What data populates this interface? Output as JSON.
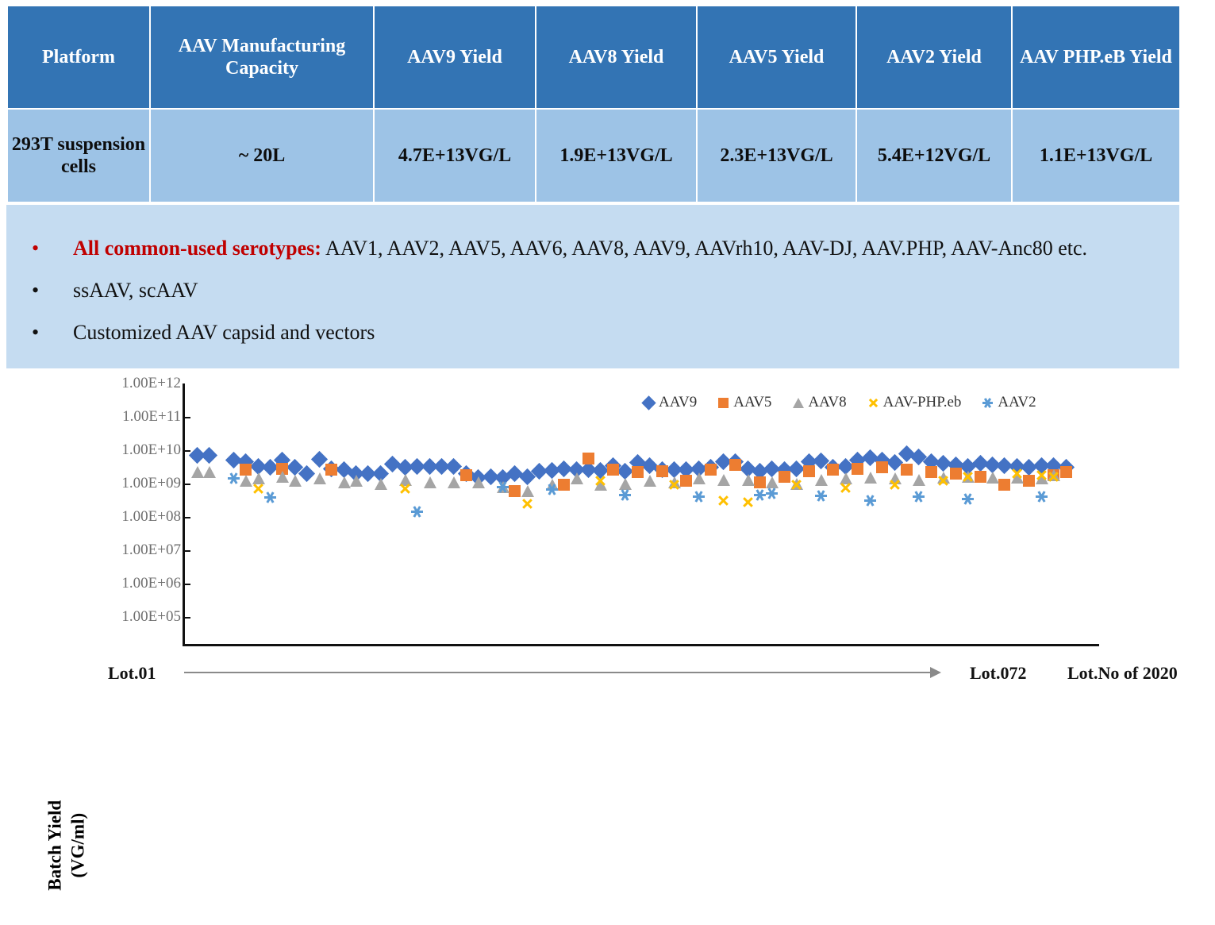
{
  "table": {
    "headers": [
      "Platform",
      "AAV Manufacturing Capacity",
      "AAV9 Yield",
      "AAV8 Yield",
      "AAV5 Yield",
      "AAV2 Yield",
      "AAV PHP.eB Yield"
    ],
    "row": [
      "293T suspension cells",
      "~ 20L",
      "4.7E+13VG/L",
      "1.9E+13VG/L",
      "2.3E+13VG/L",
      "5.4E+12VG/L",
      "1.1E+13VG/L"
    ],
    "header_bg": "#3374B4",
    "row_bg": "#9DC3E6",
    "platform_color": "#C00000"
  },
  "bullets": {
    "panel_bg": "#C5DCF1",
    "marker": "•",
    "items": [
      {
        "lead": "All common-used serotypes:",
        "rest": " AAV1, AAV2, AAV5, AAV6, AAV8, AAV9, AAVrh10, AAV-DJ, AAV.PHP, AAV-Anc80 etc.",
        "dot_color": "#C00000"
      },
      {
        "lead": "",
        "rest": "ssAAV, scAAV",
        "dot_color": "#111111"
      },
      {
        "lead": "",
        "rest": "Customized AAV capsid and vectors",
        "dot_color": "#111111"
      }
    ]
  },
  "chart_axis": {
    "y_title_line1": "Batch Yield",
    "y_title_line2": "(VG/ml)",
    "x_start_label": "Lot.01",
    "x_end_label": "Lot.072",
    "x_caption": "Lot.No of 2020"
  },
  "chart_data": {
    "type": "scatter",
    "title": "",
    "xlabel": "Lot.No of 2020",
    "ylabel": "Batch Yield (VG/ml)",
    "yscale": "log",
    "ylim": [
      100000.0,
      1000000000000.0
    ],
    "ytick_labels": [
      "1.00E+12",
      "1.00E+11",
      "1.00E+10",
      "1.00E+09",
      "1.00E+08",
      "1.00E+07",
      "1.00E+06",
      "1.00E+05"
    ],
    "ytick_values": [
      1000000000000.0,
      100000000000.0,
      10000000000.0,
      1000000000.0,
      100000000.0,
      10000000.0,
      1000000.0,
      100000.0
    ],
    "xlim": [
      1,
      72
    ],
    "grid": false,
    "legend_position": "top-right",
    "series": [
      {
        "name": "AAV9",
        "color": "#4472C4",
        "marker": "diamond",
        "x": [
          1,
          2,
          4,
          5,
          6,
          7,
          8,
          9,
          10,
          11,
          12,
          13,
          14,
          15,
          16,
          17,
          18,
          19,
          20,
          21,
          22,
          23,
          24,
          25,
          26,
          27,
          28,
          29,
          30,
          31,
          32,
          33,
          34,
          35,
          36,
          37,
          38,
          39,
          40,
          41,
          42,
          43,
          44,
          45,
          46,
          47,
          48,
          49,
          50,
          51,
          52,
          53,
          54,
          55,
          56,
          57,
          58,
          59,
          60,
          61,
          62,
          63,
          64,
          65,
          66,
          67,
          68,
          69,
          70,
          71,
          72
        ],
        "y": [
          7000000000.0,
          7000000000.0,
          5000000000.0,
          4600000000.0,
          3200000000.0,
          3100000000.0,
          5000000000.0,
          3000000000.0,
          2000000000.0,
          5300000000.0,
          2800000000.0,
          2600000000.0,
          2000000000.0,
          2000000000.0,
          2000000000.0,
          3800000000.0,
          3000000000.0,
          3200000000.0,
          3200000000.0,
          3200000000.0,
          3200000000.0,
          2000000000.0,
          1500000000.0,
          1600000000.0,
          1500000000.0,
          2000000000.0,
          1600000000.0,
          2400000000.0,
          2500000000.0,
          2700000000.0,
          2600000000.0,
          2600000000.0,
          2500000000.0,
          3500000000.0,
          2400000000.0,
          4200000000.0,
          3400000000.0,
          2600000000.0,
          2600000000.0,
          2600000000.0,
          2800000000.0,
          3000000000.0,
          4600000000.0,
          4600000000.0,
          2800000000.0,
          2400000000.0,
          2800000000.0,
          2600000000.0,
          2700000000.0,
          4600000000.0,
          4800000000.0,
          3000000000.0,
          3200000000.0,
          5000000000.0,
          6000000000.0,
          5000000000.0,
          4200000000.0,
          8000000000.0,
          6400000000.0,
          4600000000.0,
          4000000000.0,
          3600000000.0,
          3200000000.0,
          4000000000.0,
          3600000000.0,
          3400000000.0,
          3200000000.0,
          3000000000.0,
          3400000000.0,
          3400000000.0,
          3000000000.0
        ]
      },
      {
        "name": "AAV5",
        "color": "#ED7D31",
        "marker": "square",
        "x": [
          5,
          8,
          12,
          23,
          27,
          31,
          33,
          35,
          37,
          39,
          41,
          43,
          45,
          47,
          49,
          51,
          53,
          55,
          57,
          59,
          61,
          63,
          65,
          67,
          69,
          71,
          72
        ],
        "y": [
          2600000000.0,
          2800000000.0,
          2600000000.0,
          1800000000.0,
          600000000.0,
          900000000.0,
          5500000000.0,
          2600000000.0,
          2200000000.0,
          2400000000.0,
          1200000000.0,
          2600000000.0,
          3600000000.0,
          1100000000.0,
          1600000000.0,
          2400000000.0,
          2600000000.0,
          2800000000.0,
          3000000000.0,
          2600000000.0,
          2200000000.0,
          2000000000.0,
          1600000000.0,
          900000000.0,
          1200000000.0,
          1800000000.0,
          2200000000.0
        ]
      },
      {
        "name": "AAV8",
        "color": "#A5A5A5",
        "marker": "triangle",
        "x": [
          1,
          2,
          5,
          6,
          8,
          9,
          11,
          13,
          14,
          16,
          18,
          20,
          22,
          24,
          26,
          28,
          30,
          32,
          34,
          36,
          38,
          40,
          42,
          44,
          46,
          48,
          50,
          52,
          54,
          56,
          58,
          60,
          62,
          64,
          66,
          68,
          70,
          71
        ],
        "y": [
          2200000000.0,
          2200000000.0,
          1200000000.0,
          1400000000.0,
          1600000000.0,
          1200000000.0,
          1400000000.0,
          1100000000.0,
          1200000000.0,
          1000000000.0,
          1300000000.0,
          1100000000.0,
          1100000000.0,
          1100000000.0,
          800000000.0,
          600000000.0,
          900000000.0,
          1400000000.0,
          900000000.0,
          1000000000.0,
          1200000000.0,
          1100000000.0,
          1400000000.0,
          1300000000.0,
          1300000000.0,
          1100000000.0,
          1000000000.0,
          1300000000.0,
          1400000000.0,
          1500000000.0,
          1400000000.0,
          1300000000.0,
          1500000000.0,
          1600000000.0,
          1500000000.0,
          1500000000.0,
          1400000000.0,
          1800000000.0
        ]
      },
      {
        "name": "AAV-PHP.eb",
        "color": "#FFC000",
        "marker": "cross",
        "x": [
          6,
          18,
          28,
          34,
          40,
          44,
          46,
          50,
          54,
          58,
          62,
          64,
          68,
          70,
          71
        ],
        "y": [
          700000000.0,
          700000000.0,
          250000000.0,
          1200000000.0,
          900000000.0,
          300000000.0,
          280000000.0,
          900000000.0,
          750000000.0,
          900000000.0,
          1200000000.0,
          1600000000.0,
          2000000000.0,
          1800000000.0,
          1600000000.0
        ]
      },
      {
        "name": "AAV2",
        "color": "#5B9BD5",
        "marker": "asterisk",
        "x": [
          4,
          7,
          19,
          26,
          30,
          36,
          42,
          47,
          48,
          52,
          56,
          60,
          64,
          70
        ],
        "y": [
          1400000000.0,
          380000000.0,
          140000000.0,
          800000000.0,
          650000000.0,
          450000000.0,
          400000000.0,
          450000000.0,
          500000000.0,
          420000000.0,
          300000000.0,
          400000000.0,
          350000000.0,
          400000000.0
        ]
      }
    ]
  }
}
